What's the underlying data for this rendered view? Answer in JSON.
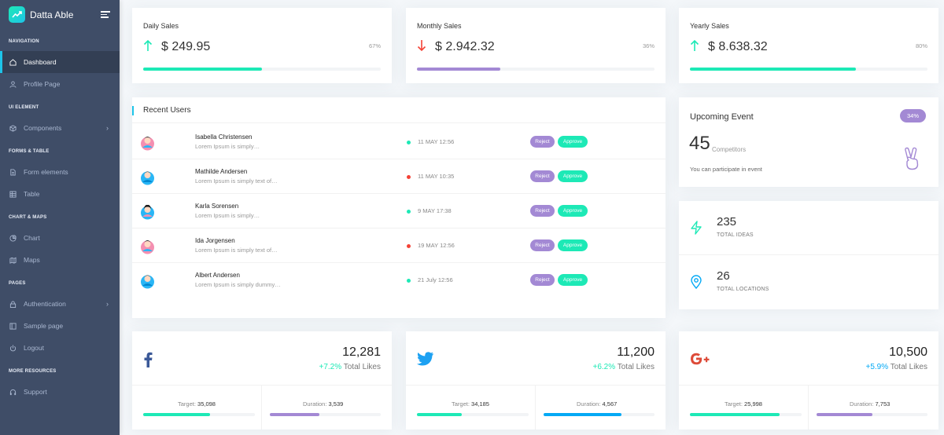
{
  "brand": {
    "name": "Datta Able"
  },
  "sidebar": {
    "sections": [
      {
        "caption": "NAVIGATION",
        "items": [
          {
            "label": "Dashboard",
            "icon": "home-icon",
            "active": true
          },
          {
            "label": "Profile Page",
            "icon": "user-icon"
          }
        ]
      },
      {
        "caption": "UI ELEMENT",
        "items": [
          {
            "label": "Components",
            "icon": "box-icon",
            "arrow": true
          }
        ]
      },
      {
        "caption": "FORMS & TABLE",
        "items": [
          {
            "label": "Form elements",
            "icon": "file-icon"
          },
          {
            "label": "Table",
            "icon": "table-icon"
          }
        ]
      },
      {
        "caption": "CHART & MAPS",
        "items": [
          {
            "label": "Chart",
            "icon": "pie-chart-icon"
          },
          {
            "label": "Maps",
            "icon": "map-icon"
          }
        ]
      },
      {
        "caption": "PAGES",
        "items": [
          {
            "label": "Authentication",
            "icon": "lock-icon",
            "arrow": true
          },
          {
            "label": "Sample page",
            "icon": "sidebar-icon"
          },
          {
            "label": "Logout",
            "icon": "power-icon"
          }
        ]
      },
      {
        "caption": "MORE RESOURCES",
        "items": [
          {
            "label": "Support",
            "icon": "headphones-icon"
          }
        ]
      }
    ]
  },
  "sales": [
    {
      "title": "Daily Sales",
      "value": "$ 249.95",
      "pct": "67%",
      "progress": 0.5,
      "trend": "up",
      "color": "#1de9b6",
      "fill_color": "#1de9b6"
    },
    {
      "title": "Monthly Sales",
      "value": "$ 2.942.32",
      "pct": "36%",
      "progress": 0.35,
      "trend": "down",
      "color": "#f44236",
      "fill_color": "#a389d4"
    },
    {
      "title": "Yearly Sales",
      "value": "$ 8.638.32",
      "pct": "80%",
      "progress": 0.7,
      "trend": "up",
      "color": "#1de9b6",
      "fill_color": "#1de9b6"
    }
  ],
  "recent_users": {
    "title": "Recent Users",
    "reject_label": "Reject",
    "approve_label": "Approve",
    "rows": [
      {
        "name": "Isabella Christensen",
        "desc": "Lorem Ipsum is simply…",
        "date": "11 MAY 12:56",
        "status_color": "#1de9b6"
      },
      {
        "name": "Mathilde Andersen",
        "desc": "Lorem Ipsum is simply text of…",
        "date": "11 MAY 10:35",
        "status_color": "#f44236"
      },
      {
        "name": "Karla Sorensen",
        "desc": "Lorem Ipsum is simply…",
        "date": "9 MAY 17:38",
        "status_color": "#1de9b6"
      },
      {
        "name": "Ida Jorgensen",
        "desc": "Lorem Ipsum is simply text of…",
        "date": "19 MAY 12:56",
        "status_color": "#f44236"
      },
      {
        "name": "Albert Andersen",
        "desc": "Lorem Ipsum is simply dummy…",
        "date": "21 July 12:56",
        "status_color": "#1de9b6"
      }
    ]
  },
  "event": {
    "title": "Upcoming Event",
    "badge": "34%",
    "count": "45",
    "count_label": "Competitors",
    "desc": "You can participate in event"
  },
  "stats": [
    {
      "value": "235",
      "label": "TOTAL IDEAS",
      "icon": "zap-icon",
      "color": "#1de9b6"
    },
    {
      "value": "26",
      "label": "TOTAL LOCATIONS",
      "icon": "map-pin-icon",
      "color": "#04a9f5"
    }
  ],
  "social": [
    {
      "network": "facebook",
      "icon": "facebook-icon",
      "color": "#3b5998",
      "value": "12,281",
      "pct": "+7.2%",
      "likes_label": "Total Likes",
      "target_label": "Target:",
      "target": "35,098",
      "duration_label": "Duration:",
      "duration": "3,539",
      "target_progress": 0.6,
      "duration_progress": 0.45,
      "target_color": "#1de9b6",
      "duration_color": "#a389d4"
    },
    {
      "network": "twitter",
      "icon": "twitter-icon",
      "color": "#1da1f2",
      "value": "11,200",
      "pct": "+6.2%",
      "likes_label": "Total Likes",
      "target_label": "Target:",
      "target": "34,185",
      "duration_label": "Duration:",
      "duration": "4,567",
      "target_progress": 0.4,
      "duration_progress": 0.7,
      "target_color": "#1de9b6",
      "duration_color": "#04a9f5"
    },
    {
      "network": "google-plus",
      "icon": "google-plus-icon",
      "color": "#dd4b39",
      "value": "10,500",
      "pct": "+5.9%",
      "likes_label": "Total Likes",
      "target_label": "Target:",
      "target": "25,998",
      "duration_label": "Duration:",
      "duration": "7,753",
      "target_progress": 0.8,
      "duration_progress": 0.5,
      "target_color": "#1de9b6",
      "duration_color": "#a389d4"
    }
  ]
}
